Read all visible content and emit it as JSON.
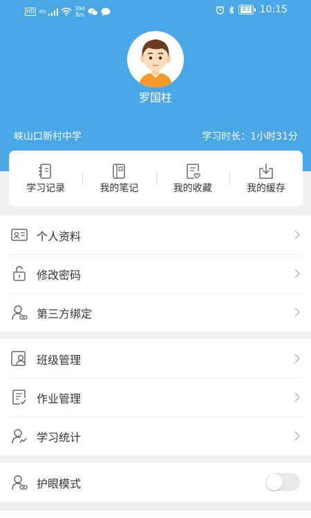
{
  "status_bar": {
    "hd": "HD",
    "network": "4G",
    "speed_value": "394",
    "speed_unit": "B/s",
    "battery": "83",
    "time": "10:15",
    "icons": [
      "signal-icon",
      "wifi-icon",
      "wechat-icon",
      "message-icon",
      "alarm-icon",
      "bluetooth-icon",
      "battery-icon"
    ]
  },
  "profile": {
    "name": "罗国柱",
    "school": "峡山口新村中学",
    "study_time": "学习时长：1小时31分",
    "avatar_icon": "boy-avatar-icon"
  },
  "quick_actions": [
    {
      "label": "学习记录",
      "icon": "notebook-icon"
    },
    {
      "label": "我的笔记",
      "icon": "note-icon"
    },
    {
      "label": "我的收藏",
      "icon": "favorite-doc-icon"
    },
    {
      "label": "我的缓存",
      "icon": "download-icon"
    }
  ],
  "menu": {
    "group1": [
      {
        "label": "个人资料",
        "icon": "id-card-icon"
      },
      {
        "label": "修改密码",
        "icon": "lock-icon"
      },
      {
        "label": "第三方绑定",
        "icon": "user-link-icon"
      }
    ],
    "group2": [
      {
        "label": "班级管理",
        "icon": "class-icon"
      },
      {
        "label": "作业管理",
        "icon": "homework-icon"
      },
      {
        "label": "学习统计",
        "icon": "stats-icon"
      }
    ],
    "group3": [
      {
        "label": "护眼模式",
        "icon": "eye-care-icon",
        "toggle_on": false
      }
    ]
  },
  "colors": {
    "header_bg": "#4aa7e6",
    "text": "#333333",
    "icon": "#666666",
    "page_bg": "#f0f0f0"
  }
}
